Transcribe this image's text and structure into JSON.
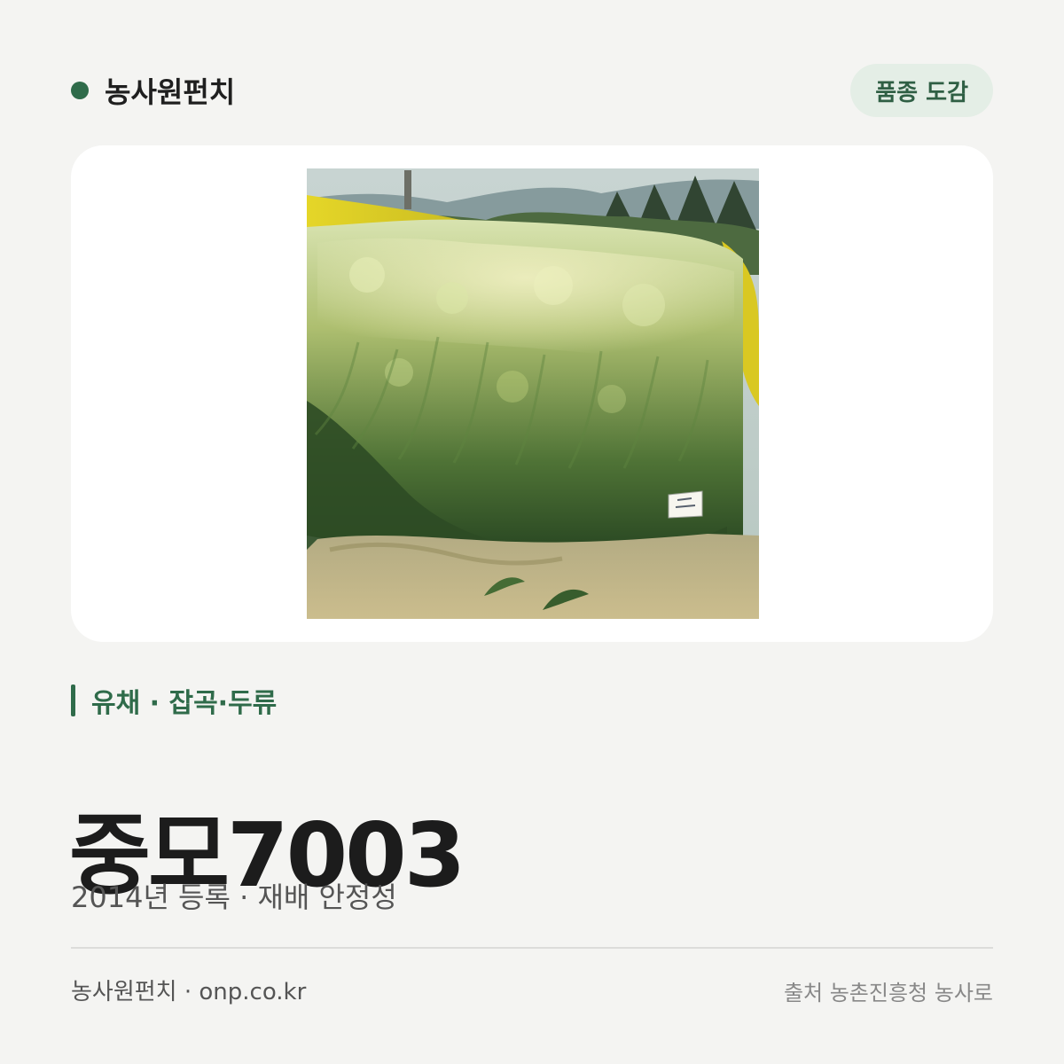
{
  "header": {
    "brand_name": "농사원펀치",
    "badge_label": "품종 도감"
  },
  "photo": {
    "subject": "rapeseed field"
  },
  "category": {
    "text": "유채 · 잡곡·두류"
  },
  "variety": {
    "name": "중모7003",
    "summary": "2014년 등록 · 재배 안정성"
  },
  "footer": {
    "site": "농사원펀치 · onp.co.kr",
    "source": "출처 농촌진흥청 농사로"
  },
  "colors": {
    "background": "#f4f4f2",
    "accent_green": "#2f6b4a",
    "badge_background": "#e4eee6",
    "card_background": "#ffffff"
  }
}
